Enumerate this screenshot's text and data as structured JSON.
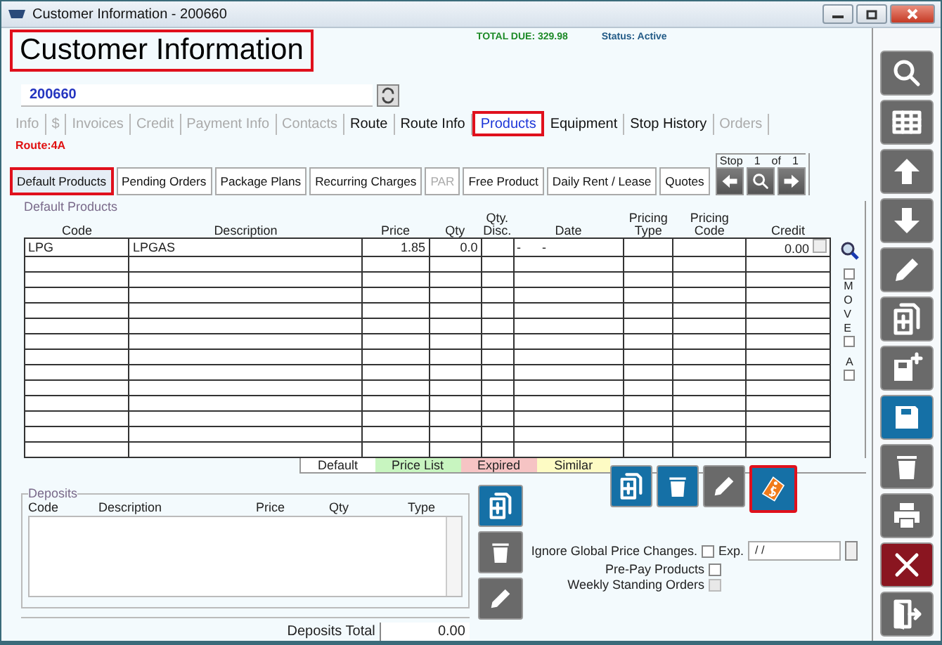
{
  "window": {
    "title": "Customer Information - 200660"
  },
  "header": {
    "title": "Customer Information",
    "highlighted": true,
    "total_due": "TOTAL DUE:  329.98",
    "status": "Status: Active"
  },
  "account": {
    "number": "200660"
  },
  "tabs": [
    {
      "label": "Info",
      "selected": false,
      "disabled": true,
      "highlighted": false
    },
    {
      "label": "$",
      "selected": false,
      "disabled": true,
      "highlighted": false
    },
    {
      "label": "Invoices",
      "selected": false,
      "disabled": true,
      "highlighted": false
    },
    {
      "label": "Credit",
      "selected": false,
      "disabled": true,
      "highlighted": false
    },
    {
      "label": "Payment Info",
      "selected": false,
      "disabled": true,
      "highlighted": false
    },
    {
      "label": "Contacts",
      "selected": false,
      "disabled": true,
      "highlighted": false
    },
    {
      "label": "Route",
      "selected": false,
      "disabled": false,
      "highlighted": false
    },
    {
      "label": "Route Info",
      "selected": false,
      "disabled": false,
      "highlighted": false
    },
    {
      "label": "Products",
      "selected": true,
      "disabled": false,
      "highlighted": true
    },
    {
      "label": "Equipment",
      "selected": false,
      "disabled": false,
      "highlighted": false
    },
    {
      "label": "Stop History",
      "selected": false,
      "disabled": false,
      "highlighted": false
    },
    {
      "label": "Orders",
      "selected": false,
      "disabled": true,
      "highlighted": false
    }
  ],
  "route": "Route:4A",
  "subtabs": [
    {
      "label": "Default Products",
      "selected": true,
      "disabled": false,
      "highlighted": true
    },
    {
      "label": "Pending Orders",
      "selected": false,
      "disabled": false,
      "highlighted": false
    },
    {
      "label": "Package Plans",
      "selected": false,
      "disabled": false,
      "highlighted": false
    },
    {
      "label": "Recurring Charges",
      "selected": false,
      "disabled": false,
      "highlighted": false
    },
    {
      "label": "PAR",
      "selected": false,
      "disabled": true,
      "highlighted": false
    },
    {
      "label": "Free Product",
      "selected": false,
      "disabled": false,
      "highlighted": false
    },
    {
      "label": "Daily Rent / Lease",
      "selected": false,
      "disabled": false,
      "highlighted": false
    },
    {
      "label": "Quotes",
      "selected": false,
      "disabled": false,
      "highlighted": false
    }
  ],
  "stop_nav": {
    "label": "Stop",
    "current": "1",
    "of": "of",
    "total": "1"
  },
  "grid": {
    "caption": "Default Products",
    "columns": [
      "Code",
      "Description",
      "Price",
      "Qty",
      "Qty. Disc.",
      "Date",
      "Pricing Type",
      "Pricing Code",
      "Credit"
    ],
    "rows": [
      {
        "cells": [
          "LPG",
          "LPGAS",
          "1.85",
          "0.0",
          "",
          "-      -",
          "",
          "",
          "0.00"
        ]
      }
    ]
  },
  "move_label": "MOVE",
  "sort_label": "A",
  "legend": [
    {
      "label": "Default",
      "color": "#ffffff"
    },
    {
      "label": "Price List",
      "color": "#c8f5c0"
    },
    {
      "label": "Expired",
      "color": "#f6c4c4"
    },
    {
      "label": "Similar",
      "color": "#fdfbc4"
    }
  ],
  "actions": [
    {
      "kind": "add",
      "color": "#1570a6",
      "highlighted": false
    },
    {
      "kind": "trash",
      "color": "#1570a6",
      "highlighted": false
    },
    {
      "kind": "pencil",
      "color": "#6a6a6a",
      "highlighted": false
    },
    {
      "kind": "tag",
      "color": "#1570a6",
      "highlighted": true
    }
  ],
  "deposits": {
    "title": "Deposits",
    "columns": [
      "Code",
      "Description",
      "Price",
      "Qty",
      "Type"
    ],
    "total_label": "Deposits Total",
    "total": "0.00"
  },
  "deposit_actions": [
    {
      "kind": "add",
      "color": "#1570a6"
    },
    {
      "kind": "trash",
      "color": "#6a6a6a"
    },
    {
      "kind": "pencil",
      "color": "#6a6a6a"
    }
  ],
  "options": [
    {
      "label": "Ignore Global Price Changes.",
      "checked": false,
      "disabled": false
    },
    {
      "label": "Pre-Pay Products",
      "checked": false,
      "disabled": false
    },
    {
      "label": "Weekly Standing Orders",
      "checked": false,
      "disabled": true
    }
  ],
  "expiry": {
    "label": "Exp.",
    "value": "/ /"
  },
  "toolbar": [
    {
      "kind": "search",
      "color": "#6a6a6a"
    },
    {
      "kind": "grid",
      "color": "#6a6a6a"
    },
    {
      "kind": "up",
      "color": "#6a6a6a"
    },
    {
      "kind": "down",
      "color": "#6a6a6a"
    },
    {
      "kind": "pencil",
      "color": "#6a6a6a"
    },
    {
      "kind": "add",
      "color": "#6a6a6a"
    },
    {
      "kind": "saveplus",
      "color": "#6a6a6a"
    },
    {
      "kind": "save",
      "color": "#1570a6"
    },
    {
      "kind": "trash",
      "color": "#6a6a6a"
    },
    {
      "kind": "print",
      "color": "#6a6a6a"
    },
    {
      "kind": "close",
      "color": "#8a1520"
    },
    {
      "kind": "exit",
      "color": "#6a6a6a"
    }
  ]
}
